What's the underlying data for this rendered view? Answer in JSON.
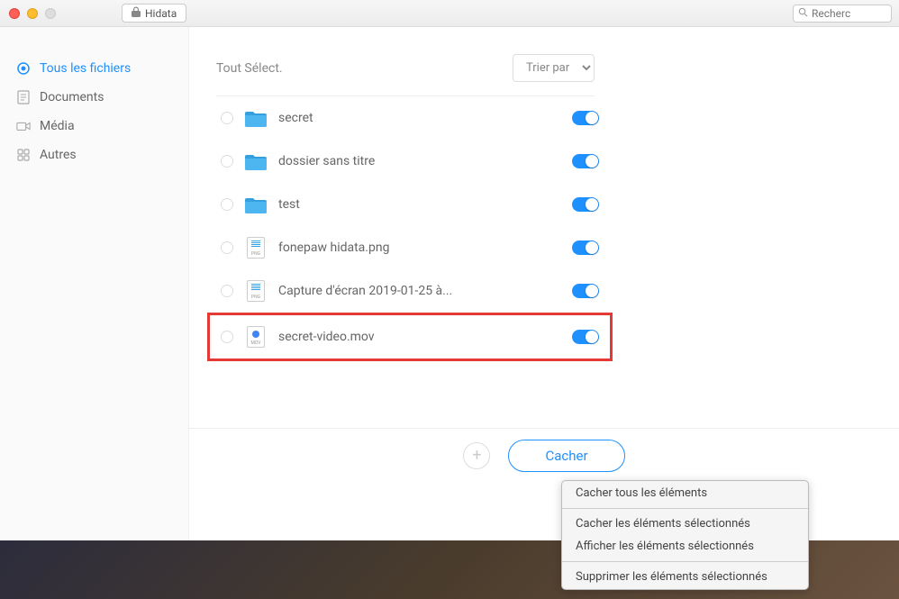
{
  "app": {
    "title": "Hidata"
  },
  "search": {
    "placeholder": "Recherc"
  },
  "sidebar": {
    "items": [
      {
        "label": "Tous les fichiers",
        "active": true
      },
      {
        "label": "Documents",
        "active": false
      },
      {
        "label": "Média",
        "active": false
      },
      {
        "label": "Autres",
        "active": false
      }
    ]
  },
  "content": {
    "select_all_label": "Tout Sélect.",
    "sort_label": "Trier par"
  },
  "files": [
    {
      "name": "secret",
      "type": "folder",
      "enabled": true,
      "highlighted": false
    },
    {
      "name": "dossier sans titre",
      "type": "folder",
      "enabled": true,
      "highlighted": false
    },
    {
      "name": "test",
      "type": "folder",
      "enabled": true,
      "highlighted": false
    },
    {
      "name": "fonepaw hidata.png",
      "type": "png",
      "enabled": true,
      "highlighted": false
    },
    {
      "name": "Capture d'écran 2019-01-25 à...",
      "type": "png",
      "enabled": true,
      "highlighted": false
    },
    {
      "name": "secret-video.mov",
      "type": "mov",
      "enabled": true,
      "highlighted": true
    }
  ],
  "actions": {
    "hide_label": "Cacher"
  },
  "context_menu": {
    "items": [
      "Cacher tous les éléments",
      "Cacher les éléments sélectionnés",
      "Afficher les éléments sélectionnés",
      "Supprimer les éléments sélectionnés"
    ]
  }
}
